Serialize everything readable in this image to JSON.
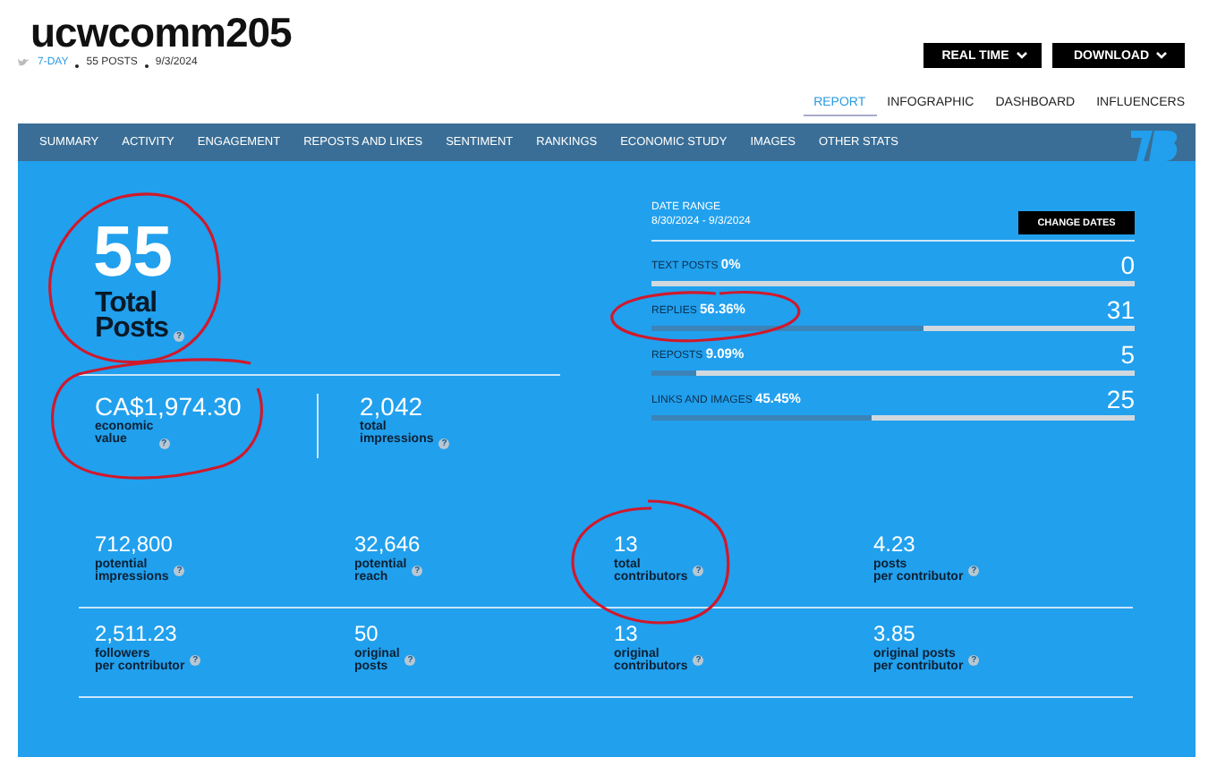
{
  "header": {
    "title": "ucwcomm205",
    "period": "7-DAY",
    "posts": "55 POSTS",
    "date": "9/3/2024"
  },
  "buttons": [
    "REAL TIME",
    "DOWNLOAD"
  ],
  "tabs": [
    {
      "label": "REPORT",
      "selected": true
    },
    {
      "label": "INFOGRAPHIC",
      "selected": false
    },
    {
      "label": "DASHBOARD",
      "selected": false
    },
    {
      "label": "INFLUENCERS",
      "selected": false
    }
  ],
  "nav": [
    "SUMMARY",
    "ACTIVITY",
    "ENGAGEMENT",
    "REPOSTS AND LIKES",
    "SENTIMENT",
    "RANKINGS",
    "ECONOMIC STUDY",
    "IMAGES",
    "OTHER STATS"
  ],
  "summary": {
    "total": "55",
    "label_lines": [
      "Total",
      "Posts"
    ],
    "help": "?"
  },
  "value_stats": [
    {
      "value": "CA$1,974.30",
      "label_lines": [
        "economic",
        "value"
      ],
      "help": "?"
    },
    {
      "value": "2,042",
      "label_lines": [
        "total",
        "impressions"
      ],
      "help": "?"
    }
  ],
  "date_range": {
    "label": "DATE RANGE",
    "value": "8/30/2024 - 9/3/2024",
    "button": "CHANGE DATES"
  },
  "breakdown": [
    {
      "label": "TEXT POSTS",
      "percent": "0%",
      "count": "0",
      "level": 0
    },
    {
      "label": "REPLIES",
      "percent": "56.36%",
      "count": "31",
      "level": 0.5636
    },
    {
      "label": "REPOSTS",
      "percent": "9.09%",
      "count": "5",
      "level": 0.0909
    },
    {
      "label": "LINKS AND IMAGES",
      "percent": "45.45%",
      "count": "25",
      "level": 0.4545
    }
  ],
  "stats": [
    [
      {
        "value": "712,800",
        "label_lines": [
          "potential",
          "impressions"
        ],
        "help": "?"
      },
      {
        "value": "32,646",
        "label_lines": [
          "potential",
          "reach"
        ],
        "help": "?"
      },
      {
        "value": "13",
        "label_lines": [
          "total",
          "contributors"
        ],
        "help": "?"
      },
      {
        "value": "4.23",
        "label_lines": [
          "posts",
          "per contributor"
        ],
        "help": "?"
      }
    ],
    [
      {
        "value": "2,511.23",
        "label_lines": [
          "followers",
          "per contributor"
        ],
        "help": "?"
      },
      {
        "value": "50",
        "label_lines": [
          "original",
          "posts"
        ],
        "help": "?"
      },
      {
        "value": "13",
        "label_lines": [
          "original",
          "contributors"
        ],
        "help": "?"
      },
      {
        "value": "3.85",
        "label_lines": [
          "original posts",
          "per contributor"
        ],
        "help": "?"
      }
    ]
  ]
}
